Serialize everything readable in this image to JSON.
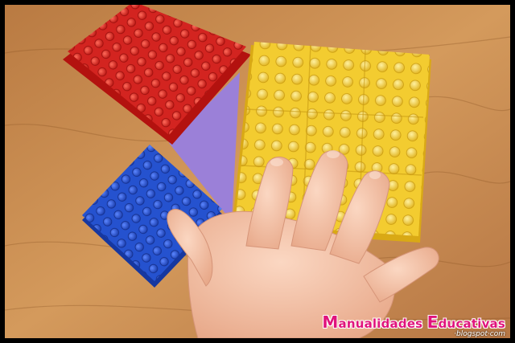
{
  "image": {
    "subject": "child's hand on coloured building bricks",
    "colors": {
      "frame": "#000000",
      "table": "#c78a4e",
      "red_bricks": "#d7201f",
      "blue_bricks": "#2450c9",
      "yellow_bricks": "#f1c82a",
      "purple_paper": "#9b7fd6",
      "skin": "#f1c3a8"
    }
  },
  "watermark": {
    "title_cap1": "M",
    "title_rest1": "anualidades ",
    "title_cap2": "E",
    "title_rest2": "ducativas",
    "subtitle": "·blogspot·com"
  }
}
